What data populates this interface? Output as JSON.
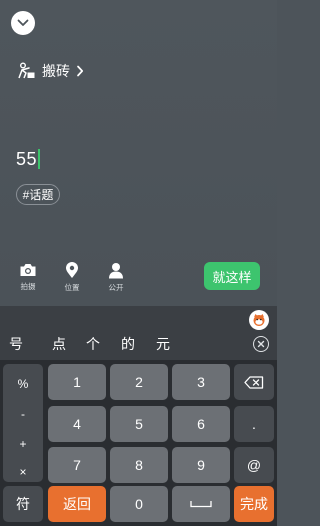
{
  "topic": {
    "label": "搬砖"
  },
  "composer": {
    "text": "55",
    "hashtag": "#话题"
  },
  "tools": [
    {
      "icon": "camera-icon",
      "label": "拍摄"
    },
    {
      "icon": "location-pin-icon",
      "label": "位置"
    },
    {
      "icon": "person-icon",
      "label": "公开"
    }
  ],
  "submit_label": "就这样",
  "ime": {
    "candidates": [
      "号",
      "点",
      "个",
      "的",
      "元"
    ]
  },
  "keyboard": {
    "symbols": [
      "%",
      "-",
      "+",
      "×"
    ],
    "rows": [
      [
        "1",
        "2",
        "3"
      ],
      [
        "4",
        "5",
        "6"
      ],
      [
        "7",
        "8",
        "9"
      ]
    ],
    "right_keys": [
      "backspace-icon",
      ".",
      "@"
    ],
    "bottom": {
      "symbol_key": "符",
      "back_key": "返回",
      "zero_key": "0",
      "space_key": "space-icon",
      "done_key": "完成"
    }
  },
  "colors": {
    "background": "#4d545a",
    "accent_green": "#3dc46e",
    "accent_orange": "#e8702f",
    "key_gray": "#6c7075",
    "keyboard_bg": "#2a2d31"
  }
}
